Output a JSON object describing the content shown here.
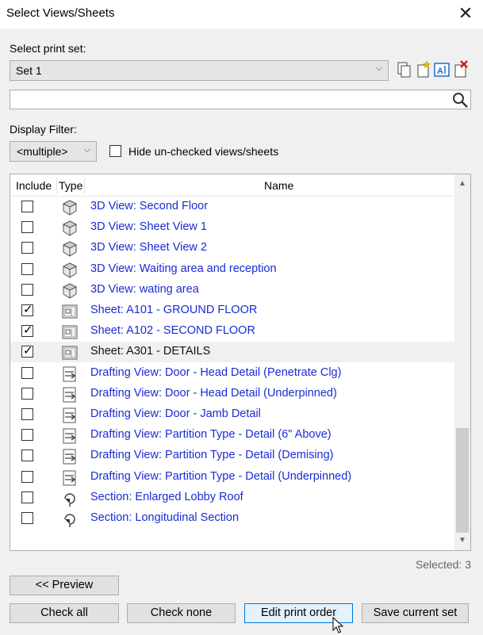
{
  "window": {
    "title": "Select Views/Sheets",
    "close_glyph": "✕"
  },
  "print_set": {
    "label": "Select print set:",
    "value": "Set 1"
  },
  "toolbar_icons": [
    "duplicate-icon",
    "new-set-icon",
    "rename-icon",
    "delete-set-icon"
  ],
  "search": {
    "value": "",
    "placeholder": ""
  },
  "filter": {
    "label": "Display Filter:",
    "value": "<multiple>",
    "hide_label": "Hide un-checked views/sheets",
    "hide_checked": false
  },
  "columns": {
    "include": "Include",
    "type": "Type",
    "name": "Name"
  },
  "rows": [
    {
      "name": "3D View: Second Floor",
      "checked": false,
      "type": "3d-view-icon"
    },
    {
      "name": "3D View: Sheet View 1",
      "checked": false,
      "type": "3d-view-icon"
    },
    {
      "name": "3D View: Sheet View 2",
      "checked": false,
      "type": "3d-view-icon"
    },
    {
      "name": "3D View: Waiting area and reception",
      "checked": false,
      "type": "3d-view-icon"
    },
    {
      "name": "3D View: wating area",
      "checked": false,
      "type": "3d-view-icon"
    },
    {
      "name": "Sheet: A101 - GROUND FLOOR",
      "checked": true,
      "type": "sheet-icon"
    },
    {
      "name": "Sheet: A102 - SECOND FLOOR",
      "checked": true,
      "type": "sheet-icon"
    },
    {
      "name": "Sheet: A301 - DETAILS",
      "checked": true,
      "type": "sheet-icon",
      "selected": true
    },
    {
      "name": "Drafting View: Door - Head Detail (Penetrate Clg)",
      "checked": false,
      "type": "drafting-view-icon"
    },
    {
      "name": "Drafting View: Door - Head Detail (Underpinned)",
      "checked": false,
      "type": "drafting-view-icon"
    },
    {
      "name": "Drafting View: Door - Jamb Detail",
      "checked": false,
      "type": "drafting-view-icon"
    },
    {
      "name": "Drafting View: Partition Type - Detail (6\" Above)",
      "checked": false,
      "type": "drafting-view-icon"
    },
    {
      "name": "Drafting View: Partition Type - Detail (Demising)",
      "checked": false,
      "type": "drafting-view-icon"
    },
    {
      "name": "Drafting View: Partition Type - Detail (Underpinned)",
      "checked": false,
      "type": "drafting-view-icon"
    },
    {
      "name": "Section: Enlarged Lobby Roof",
      "checked": false,
      "type": "section-icon"
    },
    {
      "name": "Section: Longitudinal Section",
      "checked": false,
      "type": "section-icon"
    }
  ],
  "status": {
    "selected": "Selected: 3"
  },
  "buttons": {
    "preview": "<< Preview",
    "check_all": "Check all",
    "check_none": "Check none",
    "edit_order": "Edit print order",
    "save_set": "Save current set"
  },
  "colors": {
    "link": "#1a2bd6",
    "accent": "#0078d7"
  }
}
